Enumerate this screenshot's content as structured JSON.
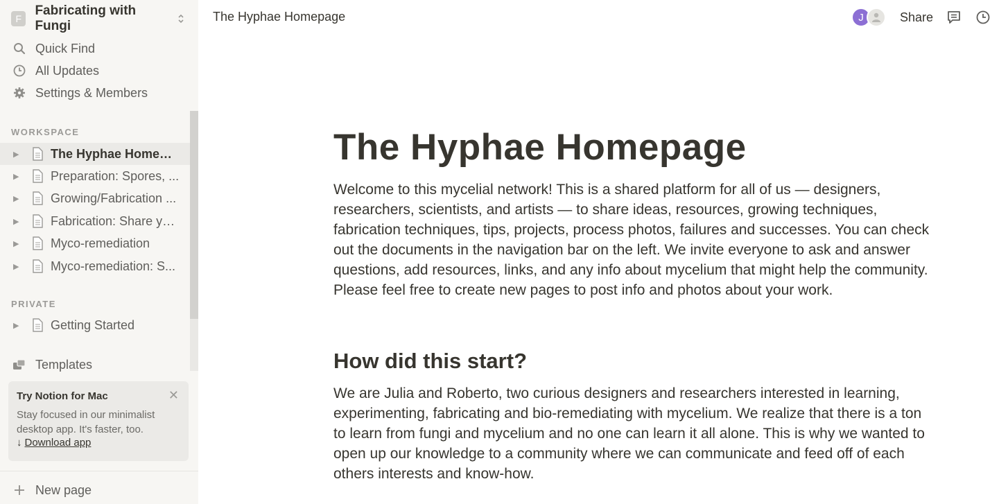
{
  "workspace": {
    "badge": "F",
    "name": "Fabricating with Fungi"
  },
  "nav": {
    "quick_find": "Quick Find",
    "all_updates": "All Updates",
    "settings": "Settings & Members"
  },
  "sections": {
    "workspace_label": "WORKSPACE",
    "private_label": "PRIVATE"
  },
  "workspace_pages": [
    {
      "label": "The Hyphae Homepage"
    },
    {
      "label": "Preparation: Spores, ..."
    },
    {
      "label": "Growing/Fabrication ..."
    },
    {
      "label": "Fabrication: Share yo..."
    },
    {
      "label": "Myco-remediation"
    },
    {
      "label": "Myco-remediation: S..."
    }
  ],
  "private_pages": [
    {
      "label": "Getting Started"
    }
  ],
  "templates_label": "Templates",
  "promo": {
    "title": "Try Notion for Mac",
    "text": "Stay focused in our minimalist desktop app. It's faster, too.",
    "link": "Download app"
  },
  "new_page_label": "New page",
  "topbar": {
    "breadcrumb": "The Hyphae Homepage",
    "avatar_initial": "J",
    "share_label": "Share"
  },
  "page": {
    "title": "The Hyphae Homepage",
    "intro": "Welcome to this mycelial network! This is a shared platform for all of us — designers, researchers, scientists, and artists — to share ideas, resources, growing techniques, fabrication techniques, tips, projects, process photos, failures and successes. You can check out the documents in the navigation bar on the left. We invite everyone to ask and answer questions, add resources, links, and any info about mycelium that might help the community. Please feel free to create new pages to post info and photos about your work.",
    "heading2": "How did this start?",
    "story": "We are Julia and Roberto, two curious designers and researchers interested in learning, experimenting, fabricating and bio-remediating with mycelium. We realize that there is a ton to learn from fungi and mycelium and no one can learn it all alone. This is why we wanted to open up our knowledge to a community where we can communicate and feed off of each others interests and know-how."
  },
  "colors": {
    "sidebar_bg": "#f7f6f3",
    "active_bg": "#ebeae7",
    "avatar": "#8c6fd4",
    "text": "#37352f"
  }
}
